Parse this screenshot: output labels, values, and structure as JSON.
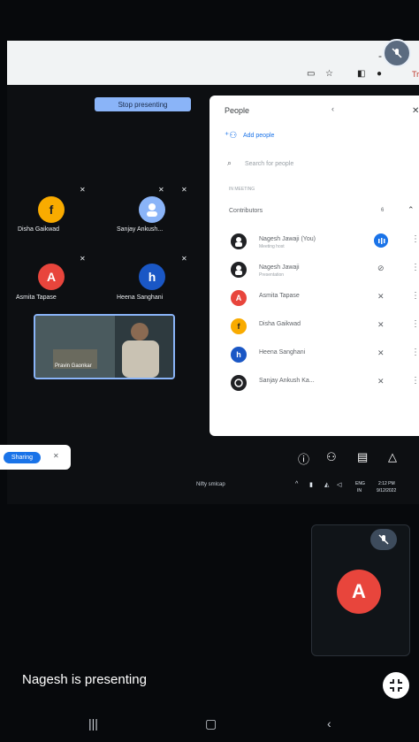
{
  "browser": {
    "minimize": "-",
    "tab_text": "Tra"
  },
  "meeting": {
    "stop_presenting_label": "Stop presenting",
    "tiles": [
      {
        "name": "Disha Gaikwad",
        "initial": "f",
        "color": "#f9ab00"
      },
      {
        "name": "Sanjay Ankush...",
        "initial": "",
        "color": "#8ab4f8"
      },
      {
        "name": "Asmita Tapase",
        "initial": "A",
        "color": "#e8453c"
      },
      {
        "name": "Heena Sanghani",
        "initial": "h",
        "color": "#1a57c5"
      }
    ],
    "video_tile_label": "Pravin Gaonkar"
  },
  "people_panel": {
    "title": "People",
    "add_people_label": "Add people",
    "search_placeholder": "Search for people",
    "section_label": "IN MEETING",
    "group_label": "Contributors",
    "group_count": "6",
    "participants": [
      {
        "name": "Nagesh Jawaji (You)",
        "sub": "Meeting host",
        "mic": "speaking"
      },
      {
        "name": "Nagesh Jawaji",
        "sub": "Presentation",
        "mic": "off"
      },
      {
        "name": "Asmita Tapase",
        "sub": "",
        "mic": "off"
      },
      {
        "name": "Disha Gaikwad",
        "sub": "",
        "mic": "off"
      },
      {
        "name": "Heena Sanghani",
        "sub": "",
        "mic": "off"
      },
      {
        "name": "Sanjay Ankush Ka...",
        "sub": "",
        "mic": "off"
      }
    ],
    "avatar_colors": [
      "#202124",
      "#202124",
      "#e8453c",
      "#f9ab00",
      "#1a57c5",
      "#202124"
    ],
    "avatar_initials": [
      "",
      "",
      "A",
      "f",
      "h",
      ""
    ]
  },
  "controls": {
    "toggle_label": "Sharing"
  },
  "taskbar": {
    "market_text": "Nifty smlcap",
    "lang": "ENG",
    "region": "IN",
    "time": "2:12 PM",
    "date": "9/12/2022"
  },
  "bottom": {
    "self_initial": "A",
    "presenting_text": "Nagesh is presenting"
  },
  "colors": {
    "accent": "#8ab4f8",
    "red": "#e8453c",
    "blue": "#1a73e8"
  }
}
